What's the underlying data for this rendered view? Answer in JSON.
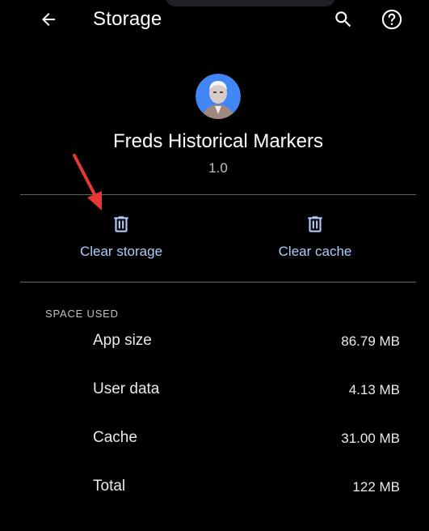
{
  "app_bar": {
    "title": "Storage",
    "back_icon": "arrow-back-icon",
    "search_icon": "search-icon",
    "help_icon": "help-circle-icon"
  },
  "app_info": {
    "name": "Freds Historical Markers",
    "version": "1.0"
  },
  "actions": [
    {
      "label": "Clear storage",
      "icon": "trash-icon"
    },
    {
      "label": "Clear cache",
      "icon": "trash-icon"
    }
  ],
  "space_used": {
    "header": "SPACE USED",
    "rows": [
      {
        "label": "App size",
        "value": "86.79 MB"
      },
      {
        "label": "User data",
        "value": "4.13 MB"
      },
      {
        "label": "Cache",
        "value": "31.00 MB"
      },
      {
        "label": "Total",
        "value": "122 MB"
      }
    ]
  },
  "colors": {
    "background": "#000000",
    "accent": "#aecbfa",
    "divider": "#5f6368",
    "annotation_arrow": "#e53935",
    "avatar_bg": "#4285f4"
  }
}
